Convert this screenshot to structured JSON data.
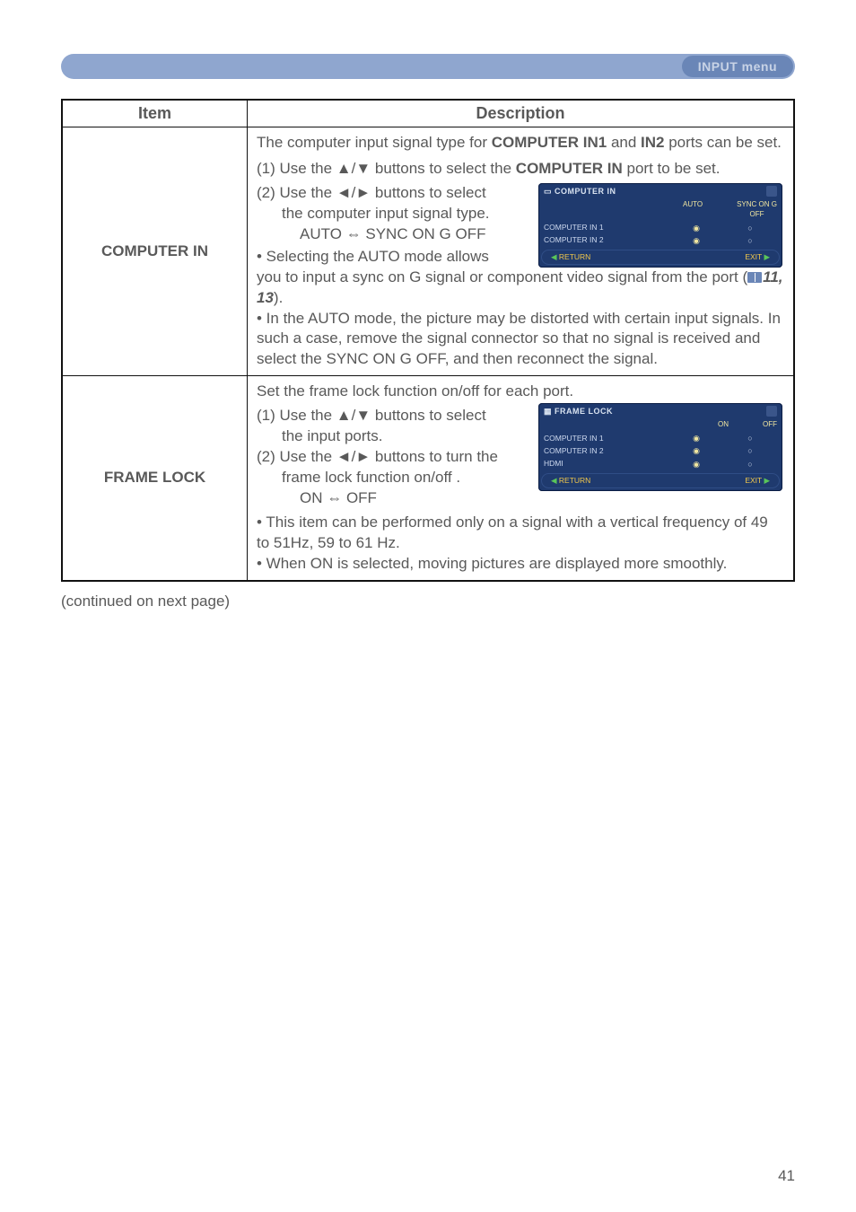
{
  "header": {
    "menu_label": "INPUT menu"
  },
  "table": {
    "headers": {
      "item": "Item",
      "desc": "Description"
    },
    "rows": [
      {
        "item": "COMPUTER IN",
        "desc": {
          "p1a": "The computer input signal type for ",
          "p1b": "COMPUTER IN1",
          "p1c": " and ",
          "p1d": "IN2",
          "p1e": " ports can be set.",
          "p2a": "(1) Use the ▲/▼ buttons to select the ",
          "p2b": "COMPUTER IN",
          "p2c": " port to be set.",
          "p3": "(2) Use the ◄/► buttons to select",
          "p3b": "the computer input signal type.",
          "p3c": "AUTO ⇔ SYNC ON G OFF",
          "p4": "• Selecting the AUTO mode allows",
          "p4b": "you to input a sync on G signal or component video signal from the port (",
          "p4ref": "11, 13",
          "p4c": ").",
          "p5": "• In the AUTO mode, the picture may be distorted with certain input signals. In such a case, remove the signal connector so that no signal is received and select the SYNC ON G OFF, and then reconnect the signal."
        },
        "osd": {
          "title": "COMPUTER IN",
          "col1": "AUTO",
          "col2_a": "SYNC ON G",
          "col2_b": "OFF",
          "row1": "COMPUTER IN 1",
          "row2": "COMPUTER IN 2",
          "return": "RETURN",
          "exit": "EXIT"
        }
      },
      {
        "item": "FRAME LOCK",
        "desc": {
          "p1": "Set the frame lock function on/off for each port.",
          "p2": "(1) Use the ▲/▼ buttons to select",
          "p2b": "the input ports.",
          "p3": "(2) Use the ◄/► buttons to turn the",
          "p3b": "frame lock function on/off .",
          "p3c": "ON ⇔ OFF",
          "p4": "• This item can be performed only on a signal with a vertical frequency of 49 to 51Hz, 59 to 61 Hz.",
          "p5": "• When ON is selected, moving pictures are displayed more smoothly."
        },
        "osd": {
          "title": "FRAME LOCK",
          "col1": "ON",
          "col2": "OFF",
          "row1": "COMPUTER IN 1",
          "row2": "COMPUTER IN 2",
          "row3": "HDMI",
          "return": "RETURN",
          "exit": "EXIT"
        }
      }
    ]
  },
  "continued": "(continued on next page)",
  "page_number": "41"
}
